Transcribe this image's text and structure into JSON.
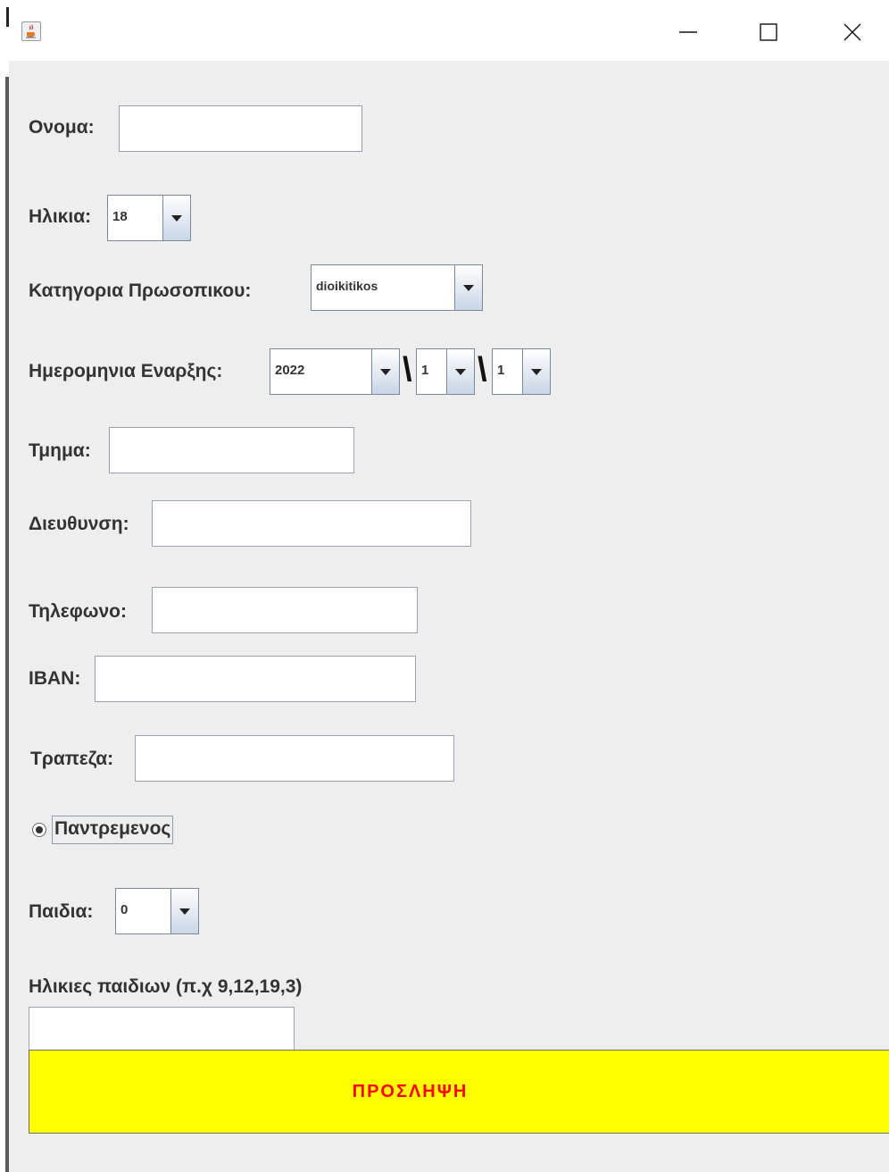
{
  "window": {
    "minimize_glyph": "—",
    "close_glyph": "✕"
  },
  "form": {
    "name_label": "Ονομα:",
    "name_value": "",
    "age_label": "Ηλικια:",
    "age_value": "18",
    "category_label": "Κατηγορια Πρωσοπικου:",
    "category_value": "dioikitikos",
    "start_date_label": "Ημερομηνια Εναρξης:",
    "start_year": "2022",
    "date_separator": "\\",
    "start_month": "1",
    "start_day": "1",
    "department_label": "Τμημα:",
    "department_value": "",
    "address_label": "Διευθυνση:",
    "address_value": "",
    "phone_label": "Τηλεφωνο:",
    "phone_value": "",
    "iban_label": "IBAN:",
    "iban_value": "",
    "bank_label": "Τραπεζα:",
    "bank_value": "",
    "married_label": "Παντρεμενος",
    "married_selected": true,
    "children_label": "Παιδια:",
    "children_value": "0",
    "children_ages_label": "Ηλικιες παιδιων (π.χ 9,12,19,3)",
    "children_ages_value": "",
    "hire_button_label": "ΠΡΟΣΛΗΨΗ"
  },
  "colors": {
    "hire_button_bg": "#ffff00",
    "hire_button_text": "#ff0000",
    "panel_bg": "#eeeeee"
  },
  "icons": {
    "app": "java-coffee-icon",
    "minimize": "minimize-icon",
    "maximize": "maximize-icon",
    "close": "close-icon",
    "dropdown": "chevron-down-icon"
  }
}
